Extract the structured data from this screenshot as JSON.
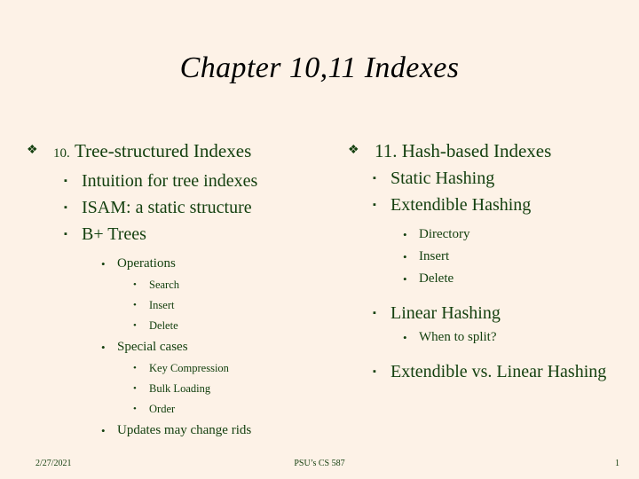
{
  "slide": {
    "title": "Chapter 10,11 Indexes",
    "background_color": "#fdf2e7",
    "text_color": "#14400f",
    "title_color": "#000000"
  },
  "bullets": {
    "diamond": "❖",
    "square": "▪",
    "round": "•",
    "round_small": "•"
  },
  "left_column": {
    "heading_number": "10.",
    "heading_text": "Tree-structured Indexes",
    "items": [
      {
        "level": 2,
        "label": "Intuition for tree indexes"
      },
      {
        "level": 2,
        "label": "ISAM: a static structure"
      },
      {
        "level": 2,
        "label": "B+ Trees"
      },
      {
        "level": 3,
        "label": "Operations"
      },
      {
        "level": 4,
        "label": "Search"
      },
      {
        "level": 4,
        "label": "Insert"
      },
      {
        "level": 4,
        "label": "Delete"
      },
      {
        "level": 3,
        "label": "Special cases"
      },
      {
        "level": 4,
        "label": "Key Compression"
      },
      {
        "level": 4,
        "label": "Bulk Loading"
      },
      {
        "level": 4,
        "label": "Order"
      },
      {
        "level": 3,
        "label": "Updates may change rids"
      }
    ]
  },
  "right_column": {
    "heading_number": "11.",
    "heading_text": "Hash-based Indexes",
    "items": [
      {
        "level": 2,
        "label": "Static Hashing"
      },
      {
        "level": 2,
        "label": "Extendible Hashing"
      },
      {
        "level": 3,
        "label": "Directory"
      },
      {
        "level": 3,
        "label": "Insert"
      },
      {
        "level": 3,
        "label": "Delete"
      },
      {
        "level": 2,
        "label": "Linear Hashing"
      },
      {
        "level": 3,
        "label": "When to split?"
      },
      {
        "level": 2,
        "label": "Extendible vs. Linear Hashing"
      }
    ]
  },
  "footer": {
    "date": "2/27/2021",
    "center": "PSU’s CS 587",
    "page_number": "1"
  }
}
